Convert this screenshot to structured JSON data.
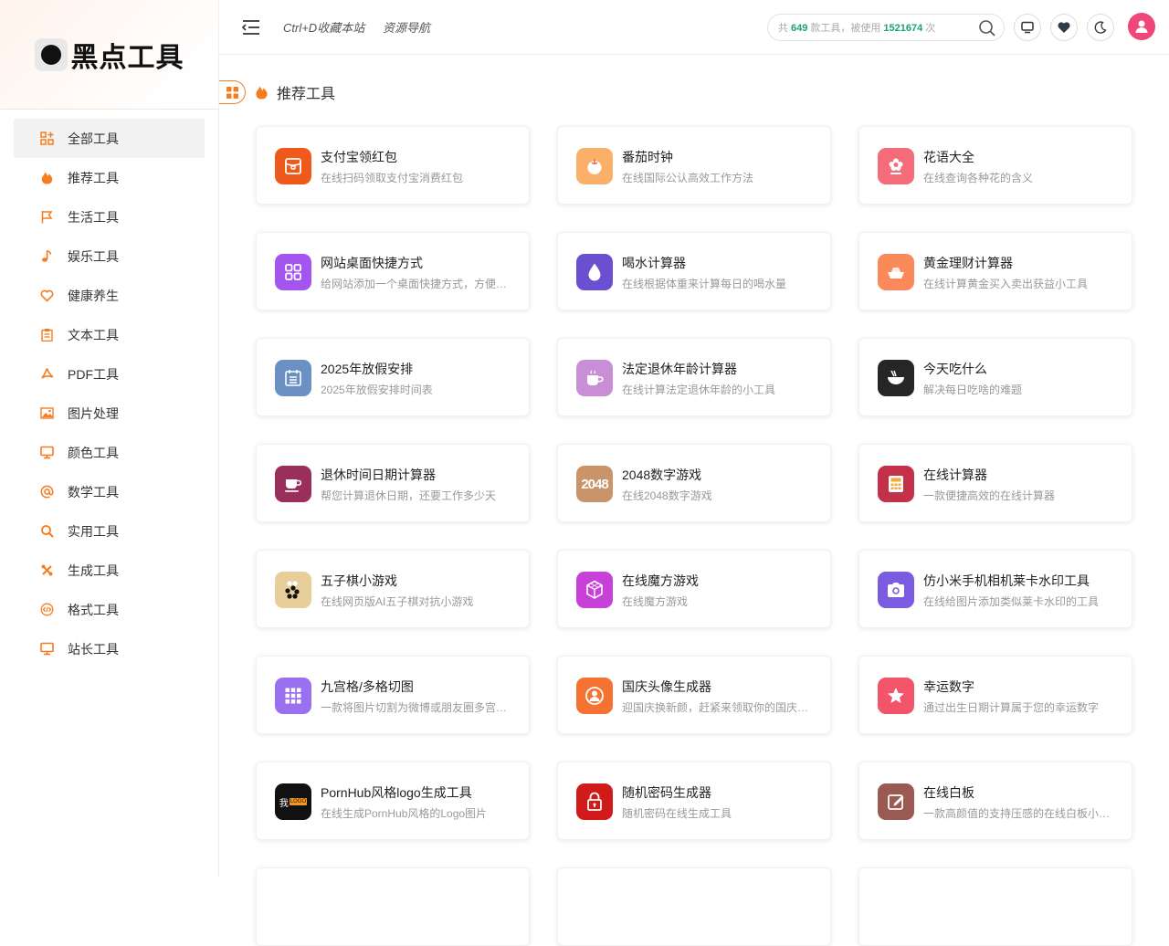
{
  "logo": {
    "text": "黑点工具"
  },
  "topbar": {
    "link1": "Ctrl+D收藏本站",
    "link2": "资源导航",
    "search_prefix": "共",
    "tool_count": "649",
    "search_mid": "款工具，被使用",
    "use_count": "1521674",
    "search_suffix": "次"
  },
  "sidebar": {
    "items": [
      {
        "label": "全部工具",
        "icon": "grid-plus-icon"
      },
      {
        "label": "推荐工具",
        "icon": "hot-icon"
      },
      {
        "label": "生活工具",
        "icon": "flag-icon"
      },
      {
        "label": "娱乐工具",
        "icon": "music-icon"
      },
      {
        "label": "健康养生",
        "icon": "heart-icon"
      },
      {
        "label": "文本工具",
        "icon": "clipboard-icon"
      },
      {
        "label": "PDF工具",
        "icon": "pdf-icon"
      },
      {
        "label": "图片处理",
        "icon": "image-icon"
      },
      {
        "label": "颜色工具",
        "icon": "monitor-icon"
      },
      {
        "label": "数学工具",
        "icon": "at-icon"
      },
      {
        "label": "实用工具",
        "icon": "search-icon"
      },
      {
        "label": "生成工具",
        "icon": "tools-icon"
      },
      {
        "label": "格式工具",
        "icon": "code-icon"
      },
      {
        "label": "站长工具",
        "icon": "monitor-icon"
      }
    ]
  },
  "section": {
    "title": "推荐工具"
  },
  "tools": [
    {
      "title": "支付宝领红包",
      "desc": "在线扫码领取支付宝消费红包",
      "icon": "red-envelope-icon",
      "color": "#ef5a1c"
    },
    {
      "title": "番茄时钟",
      "desc": "在线国际公认高效工作方法",
      "icon": "tomato-icon",
      "color": "#fbb06a"
    },
    {
      "title": "花语大全",
      "desc": "在线查询各种花的含义",
      "icon": "flower-icon",
      "color": "#f56b7a"
    },
    {
      "title": "网站桌面快捷方式",
      "desc": "给网站添加一个桌面快捷方式，方便快速访问",
      "icon": "shortcut-icon",
      "color": "#a455f0"
    },
    {
      "title": "喝水计算器",
      "desc": "在线根据体重来计算每日的喝水量",
      "icon": "water-drop-icon",
      "color": "#6a4fd0"
    },
    {
      "title": "黄金理财计算器",
      "desc": "在线计算黄金买入卖出获益小工具",
      "icon": "gold-icon",
      "color": "#fb8a5a"
    },
    {
      "title": "2025年放假安排",
      "desc": "2025年放假安排时间表",
      "icon": "calendar-icon",
      "color": "#6b90c4"
    },
    {
      "title": "法定退休年龄计算器",
      "desc": "在线计算法定退休年龄的小工具",
      "icon": "cup-icon",
      "color": "#c98fd6"
    },
    {
      "title": "今天吃什么",
      "desc": "解决每日吃啥的难题",
      "icon": "bowl-icon",
      "color": "#262626"
    },
    {
      "title": "退休时间日期计算器",
      "desc": "帮您计算退休日期，还要工作多少天",
      "icon": "coffee-icon",
      "color": "#9a2f5c"
    },
    {
      "title": "2048数字游戏",
      "desc": "在线2048数字游戏",
      "icon": "game-2048-icon",
      "color": "#c9946a",
      "badge": "2048"
    },
    {
      "title": "在线计算器",
      "desc": "一款便捷高效的在线计算器",
      "icon": "calculator-icon",
      "color": "#c3304a"
    },
    {
      "title": "五子棋小游戏",
      "desc": "在线网页版AI五子棋对抗小游戏",
      "icon": "gomoku-icon",
      "color": "#e8cf9a"
    },
    {
      "title": "在线魔方游戏",
      "desc": "在线魔方游戏",
      "icon": "cube-icon",
      "color": "#c740d8"
    },
    {
      "title": "仿小米手机相机莱卡水印工具",
      "desc": "在线给图片添加类似莱卡水印的工具",
      "icon": "camera-icon",
      "color": "#7b5ce0"
    },
    {
      "title": "九宫格/多格切图",
      "desc": "一款将图片切割为微博或朋友圈多宫格的工具",
      "icon": "nine-grid-icon",
      "color": "#9a6ff0"
    },
    {
      "title": "国庆头像生成器",
      "desc": "迎国庆换新颜，赶紧来领取你的国庆头像吧",
      "icon": "avatar-icon",
      "color": "#f57332"
    },
    {
      "title": "幸运数字",
      "desc": "通过出生日期计算属于您的幸运数字",
      "icon": "star-icon",
      "color": "#f2556a"
    },
    {
      "title": "PornHub风格logo生成工具",
      "desc": "在线生成PornHub风格的Logo图片",
      "icon": "logo-gen-icon",
      "color": "#111111",
      "badge_left": "我",
      "badge_right": "LOGO"
    },
    {
      "title": "随机密码生成器",
      "desc": "随机密码在线生成工具",
      "icon": "lock-icon",
      "color": "#d11a1a"
    },
    {
      "title": "在线白板",
      "desc": "一款高颜值的支持压感的在线白板小工具",
      "icon": "whiteboard-icon",
      "color": "#9a5a52"
    }
  ]
}
